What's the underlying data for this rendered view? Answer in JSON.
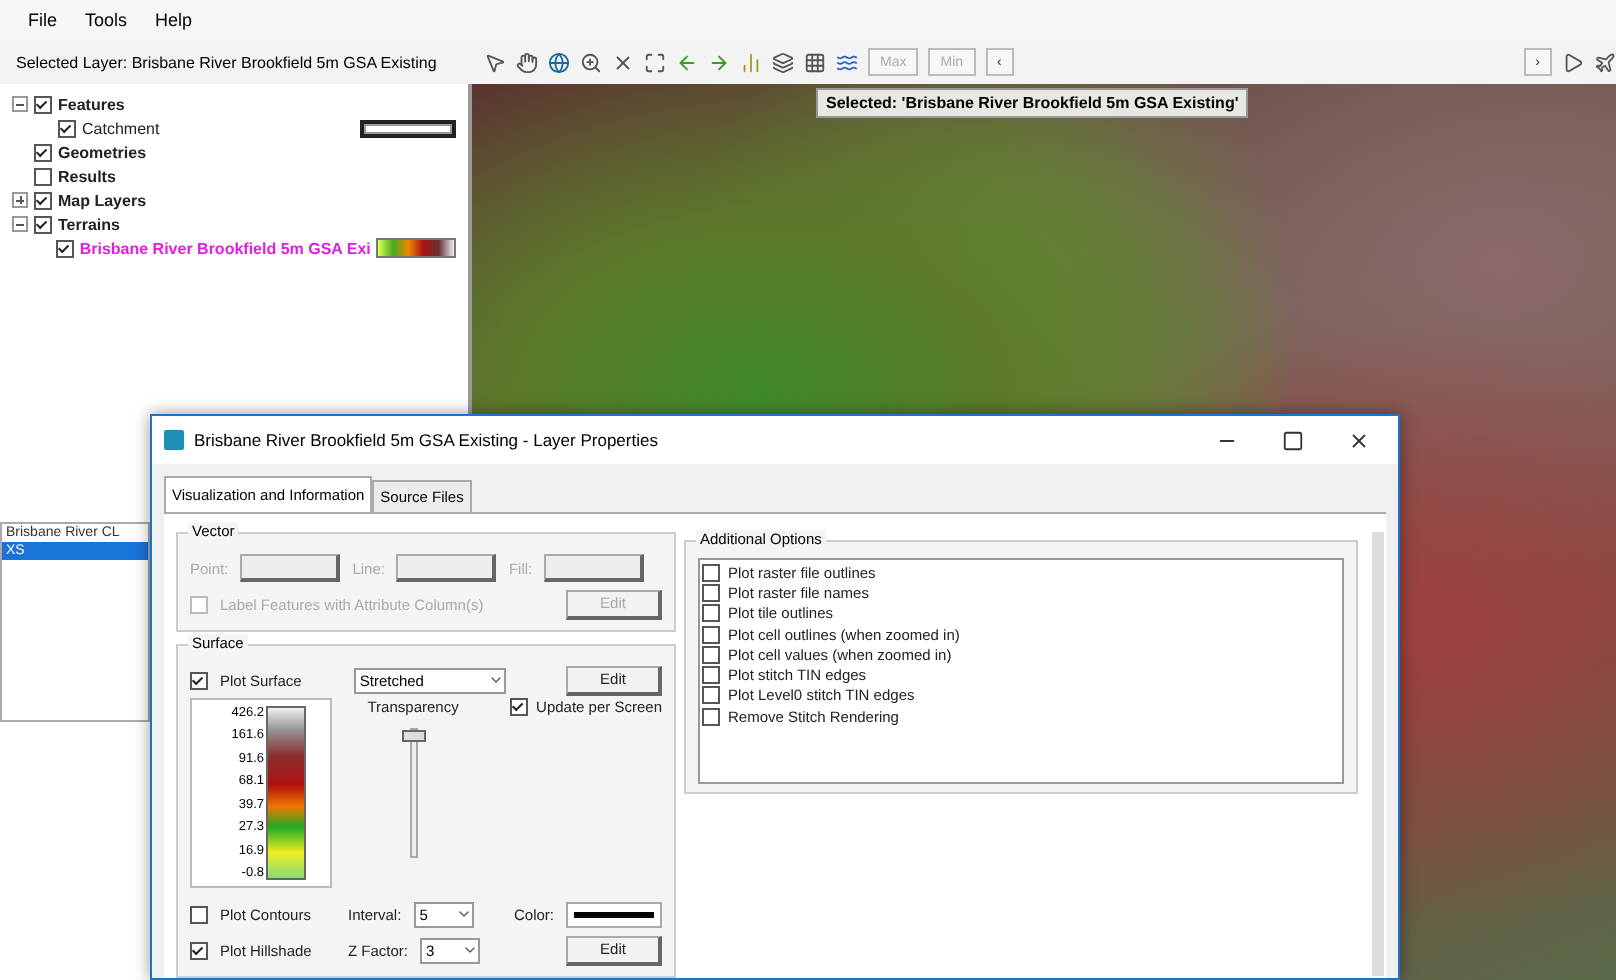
{
  "menu": [
    "File",
    "Tools",
    "Help"
  ],
  "selected_layer": "Selected Layer: Brisbane River Brookfield 5m GSA Existing",
  "toolbar": {
    "text_buttons": [
      {
        "label": "Max",
        "disabled": true
      },
      {
        "label": "Min",
        "disabled": true
      },
      {
        "label": "‹",
        "disabled": false
      }
    ],
    "right_buttons": [
      "›"
    ]
  },
  "tree": [
    {
      "label": "Features",
      "checked": true,
      "expanded": true,
      "bold": true,
      "children": [
        {
          "label": "Catchment",
          "checked": true,
          "bold": false,
          "kind": "line"
        }
      ]
    },
    {
      "label": "Geometries",
      "checked": true,
      "bold": true
    },
    {
      "label": "Results",
      "checked": false,
      "bold": true
    },
    {
      "label": "Map Layers",
      "checked": true,
      "expanded": false,
      "bold": true
    },
    {
      "label": "Terrains",
      "checked": true,
      "expanded": true,
      "bold": true,
      "children": [
        {
          "label": "Brisbane River Brookfield 5m GSA Exi",
          "checked": true,
          "bold": true,
          "kind": "ramp",
          "highlight": true
        }
      ]
    }
  ],
  "layers_list": [
    {
      "label": "Brisbane River CL",
      "selected": false
    },
    {
      "label": "XS",
      "selected": true
    }
  ],
  "map": {
    "tooltip": "Selected: 'Brisbane River Brookfield 5m GSA Existing'"
  },
  "dialog": {
    "title": "Brisbane River Brookfield 5m GSA Existing - Layer Properties",
    "tabs": [
      {
        "label": "Visualization and Information",
        "selected": true
      },
      {
        "label": "Source Files",
        "selected": false
      }
    ],
    "vector": {
      "title": "Vector",
      "point": "Point:",
      "line": "Line:",
      "fill": "Fill:",
      "label_features": {
        "label": "Label Features with Attribute Column(s)",
        "checked": false,
        "disabled": true
      },
      "edit": {
        "label": "Edit",
        "disabled": true
      }
    },
    "surface": {
      "title": "Surface",
      "plot_surface": {
        "label": "Plot Surface",
        "checked": true
      },
      "mode": "Stretched",
      "edit": "Edit",
      "update_per_screen": {
        "label": "Update per Screen",
        "checked": true
      },
      "legend": [
        "426.2",
        "161.6",
        "91.6",
        "68.1",
        "39.7",
        "27.3",
        "16.9",
        "-0.8"
      ],
      "transparency": {
        "label": "Transparency",
        "level": 1
      },
      "plot_contours": {
        "label": "Plot Contours",
        "checked": false
      },
      "interval_label": "Interval:",
      "interval": "5",
      "color_label": "Color:",
      "plot_hillshade": {
        "label": "Plot Hillshade",
        "checked": true
      },
      "zfactor_label": "Z Factor:",
      "zfactor": "3",
      "hillshade_edit": "Edit"
    },
    "options": {
      "title": "Additional Options",
      "items": [
        {
          "label": "Plot raster file outlines",
          "checked": false
        },
        {
          "label": "Plot raster file names",
          "checked": false
        },
        {
          "label": "Plot tile outlines",
          "checked": false
        },
        {
          "label": "Plot cell outlines (when zoomed in)",
          "checked": false
        },
        {
          "label": "Plot cell values (when zoomed in)",
          "checked": false
        },
        {
          "label": "Plot stitch TIN edges",
          "checked": false
        },
        {
          "label": "Plot Level0 stitch TIN edges",
          "checked": false
        },
        {
          "label": "Remove Stitch Rendering",
          "checked": false
        }
      ]
    }
  }
}
